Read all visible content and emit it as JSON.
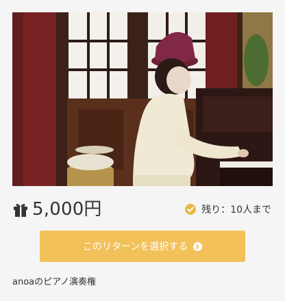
{
  "reward": {
    "price": "5,000円",
    "remaining": "残り：10人まで",
    "select_label": "このリターンを選択する",
    "description": "anoaのピアノ演奏権"
  },
  "icons": {
    "gift": "gift-icon",
    "check": "check-circle-icon",
    "arrow": "chevron-right-circle-icon"
  },
  "colors": {
    "background": "#f5f5f5",
    "button": "#f2c15a",
    "check": "#e9b94a",
    "text": "#333333"
  }
}
